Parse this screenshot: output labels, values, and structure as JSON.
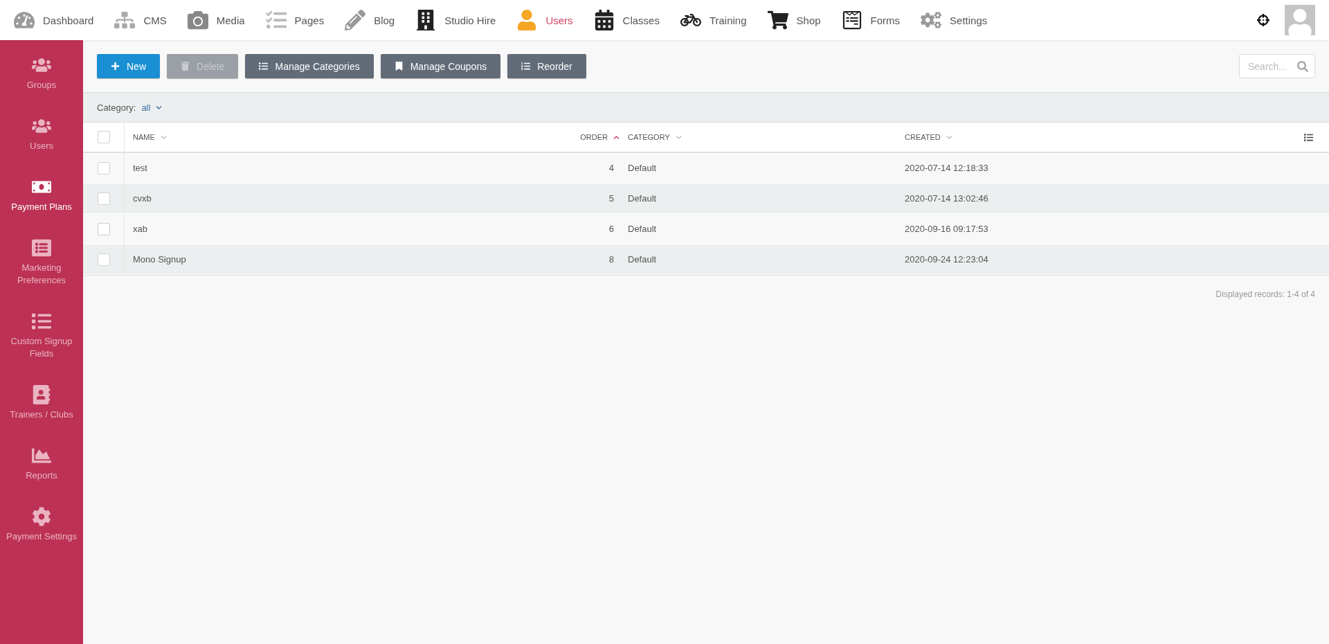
{
  "top_nav": [
    {
      "label": "Dashboard",
      "selected": false
    },
    {
      "label": "CMS",
      "selected": false
    },
    {
      "label": "Media",
      "selected": false
    },
    {
      "label": "Pages",
      "selected": false
    },
    {
      "label": "Blog",
      "selected": false
    },
    {
      "label": "Studio Hire",
      "selected": false
    },
    {
      "label": "Users",
      "selected": true
    },
    {
      "label": "Classes",
      "selected": false
    },
    {
      "label": "Training",
      "selected": false
    },
    {
      "label": "Shop",
      "selected": false
    },
    {
      "label": "Forms",
      "selected": false
    },
    {
      "label": "Settings",
      "selected": false
    }
  ],
  "sidebar": {
    "items": [
      {
        "label": "Groups",
        "selected": false
      },
      {
        "label": "Users",
        "selected": false
      },
      {
        "label": "Payment Plans",
        "selected": true
      },
      {
        "label": "Marketing Preferences",
        "selected": false
      },
      {
        "label": "Custom Signup Fields",
        "selected": false
      },
      {
        "label": "Trainers / Clubs",
        "selected": false
      },
      {
        "label": "Reports",
        "selected": false
      },
      {
        "label": "Payment Settings",
        "selected": false
      }
    ]
  },
  "toolbar": {
    "buttons": [
      {
        "label": "New",
        "kind": "primary",
        "disabled": false
      },
      {
        "label": "Delete",
        "kind": "secondary",
        "disabled": true
      },
      {
        "label": "Manage Categories",
        "kind": "secondary",
        "disabled": false
      },
      {
        "label": "Manage Coupons",
        "kind": "secondary",
        "disabled": false
      },
      {
        "label": "Reorder",
        "kind": "secondary",
        "disabled": false
      }
    ],
    "search": {
      "placeholder": "Search..."
    }
  },
  "filter": {
    "label": "Category:",
    "value": "all"
  },
  "table": {
    "select_all": {
      "checked": false
    },
    "columns": [
      {
        "label": "NAME",
        "sorted": false
      },
      {
        "label": "ORDER",
        "sorted": true
      },
      {
        "label": "CATEGORY",
        "sorted": false
      },
      {
        "label": "CREATED",
        "sorted": false
      }
    ],
    "rows": [
      {
        "checked": false,
        "cells": [
          "test",
          "4",
          "Default",
          "2020-07-14 12:18:33"
        ]
      },
      {
        "checked": false,
        "cells": [
          "cvxb",
          "5",
          "Default",
          "2020-07-14 13:02:46"
        ]
      },
      {
        "checked": false,
        "cells": [
          "xab",
          "6",
          "Default",
          "2020-09-16 09:17:53"
        ]
      },
      {
        "checked": false,
        "cells": [
          "Mono Signup",
          "8",
          "Default",
          "2020-09-24 12:23:04"
        ]
      }
    ]
  },
  "footer": {
    "records": "Displayed records: 1-4 of 4"
  }
}
